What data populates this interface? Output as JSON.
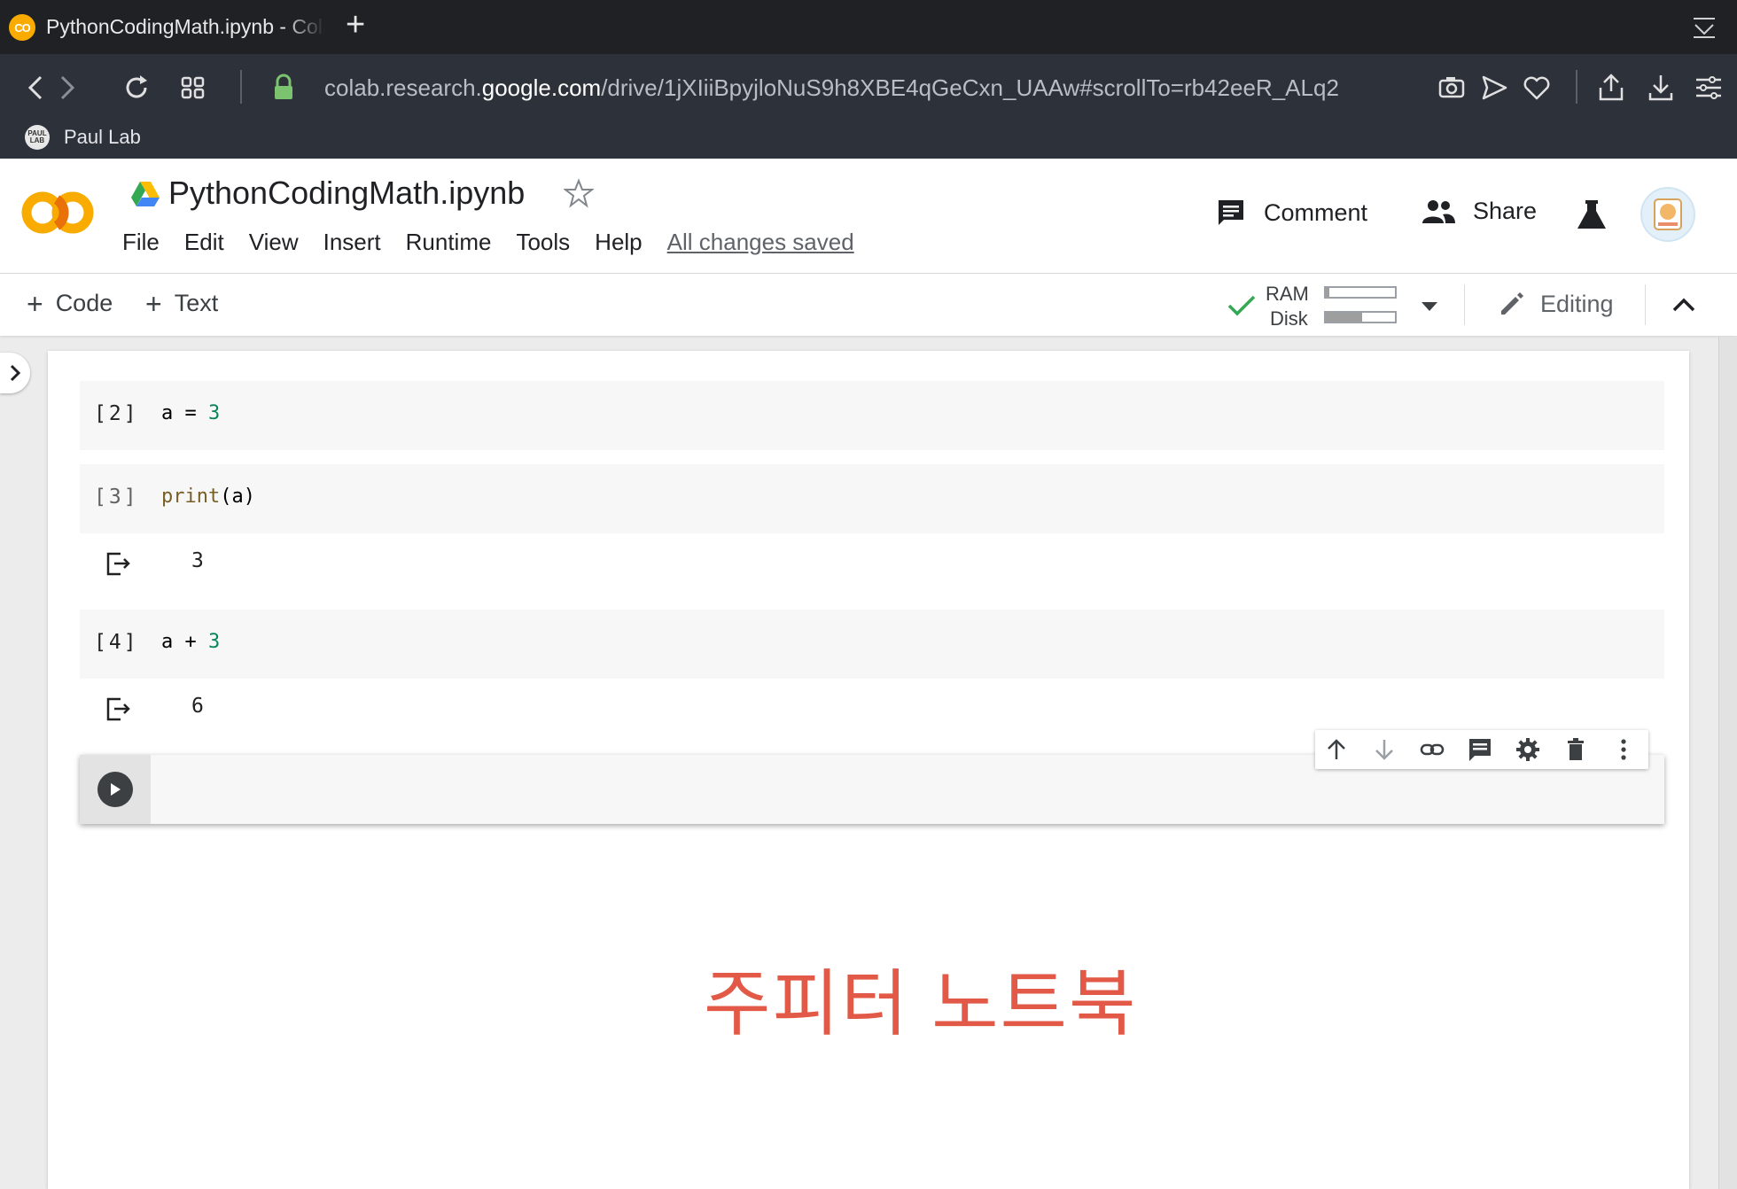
{
  "browser": {
    "tab_title": "PythonCodingMath.ipynb - Colab",
    "favicon_text": "CO",
    "url_prefix": "colab.research.",
    "url_domain": "google.com",
    "url_path": "/drive/1jXIiiBpyjloNuS9h8XBE4qGeCxn_UAAw#scrollTo=rb42eeR_ALq2",
    "bookmark_label": "Paul Lab",
    "bookmark_icon_text": "PAUL LAB"
  },
  "header": {
    "notebook_title": "PythonCodingMath.ipynb",
    "menu": [
      "File",
      "Edit",
      "View",
      "Insert",
      "Runtime",
      "Tools",
      "Help"
    ],
    "save_status": "All changes saved",
    "comment_label": "Comment",
    "share_label": "Share"
  },
  "toolbar": {
    "add_code_label": "Code",
    "add_text_label": "Text",
    "ram_label": "RAM",
    "disk_label": "Disk",
    "ram_usage": 0.05,
    "disk_usage": 0.52,
    "editing_label": "Editing"
  },
  "cells": [
    {
      "exec": "[2]",
      "code": "a = 3"
    },
    {
      "exec": "[3]",
      "code": "print(a)",
      "output": "3"
    },
    {
      "exec": "[4]",
      "code": "a + 3",
      "output": "6"
    }
  ],
  "annotation": "주피터 노트북",
  "colors": {
    "accent_orange": "#f9ab00",
    "annotation_red": "#e25a47",
    "check_green": "#34a853"
  }
}
